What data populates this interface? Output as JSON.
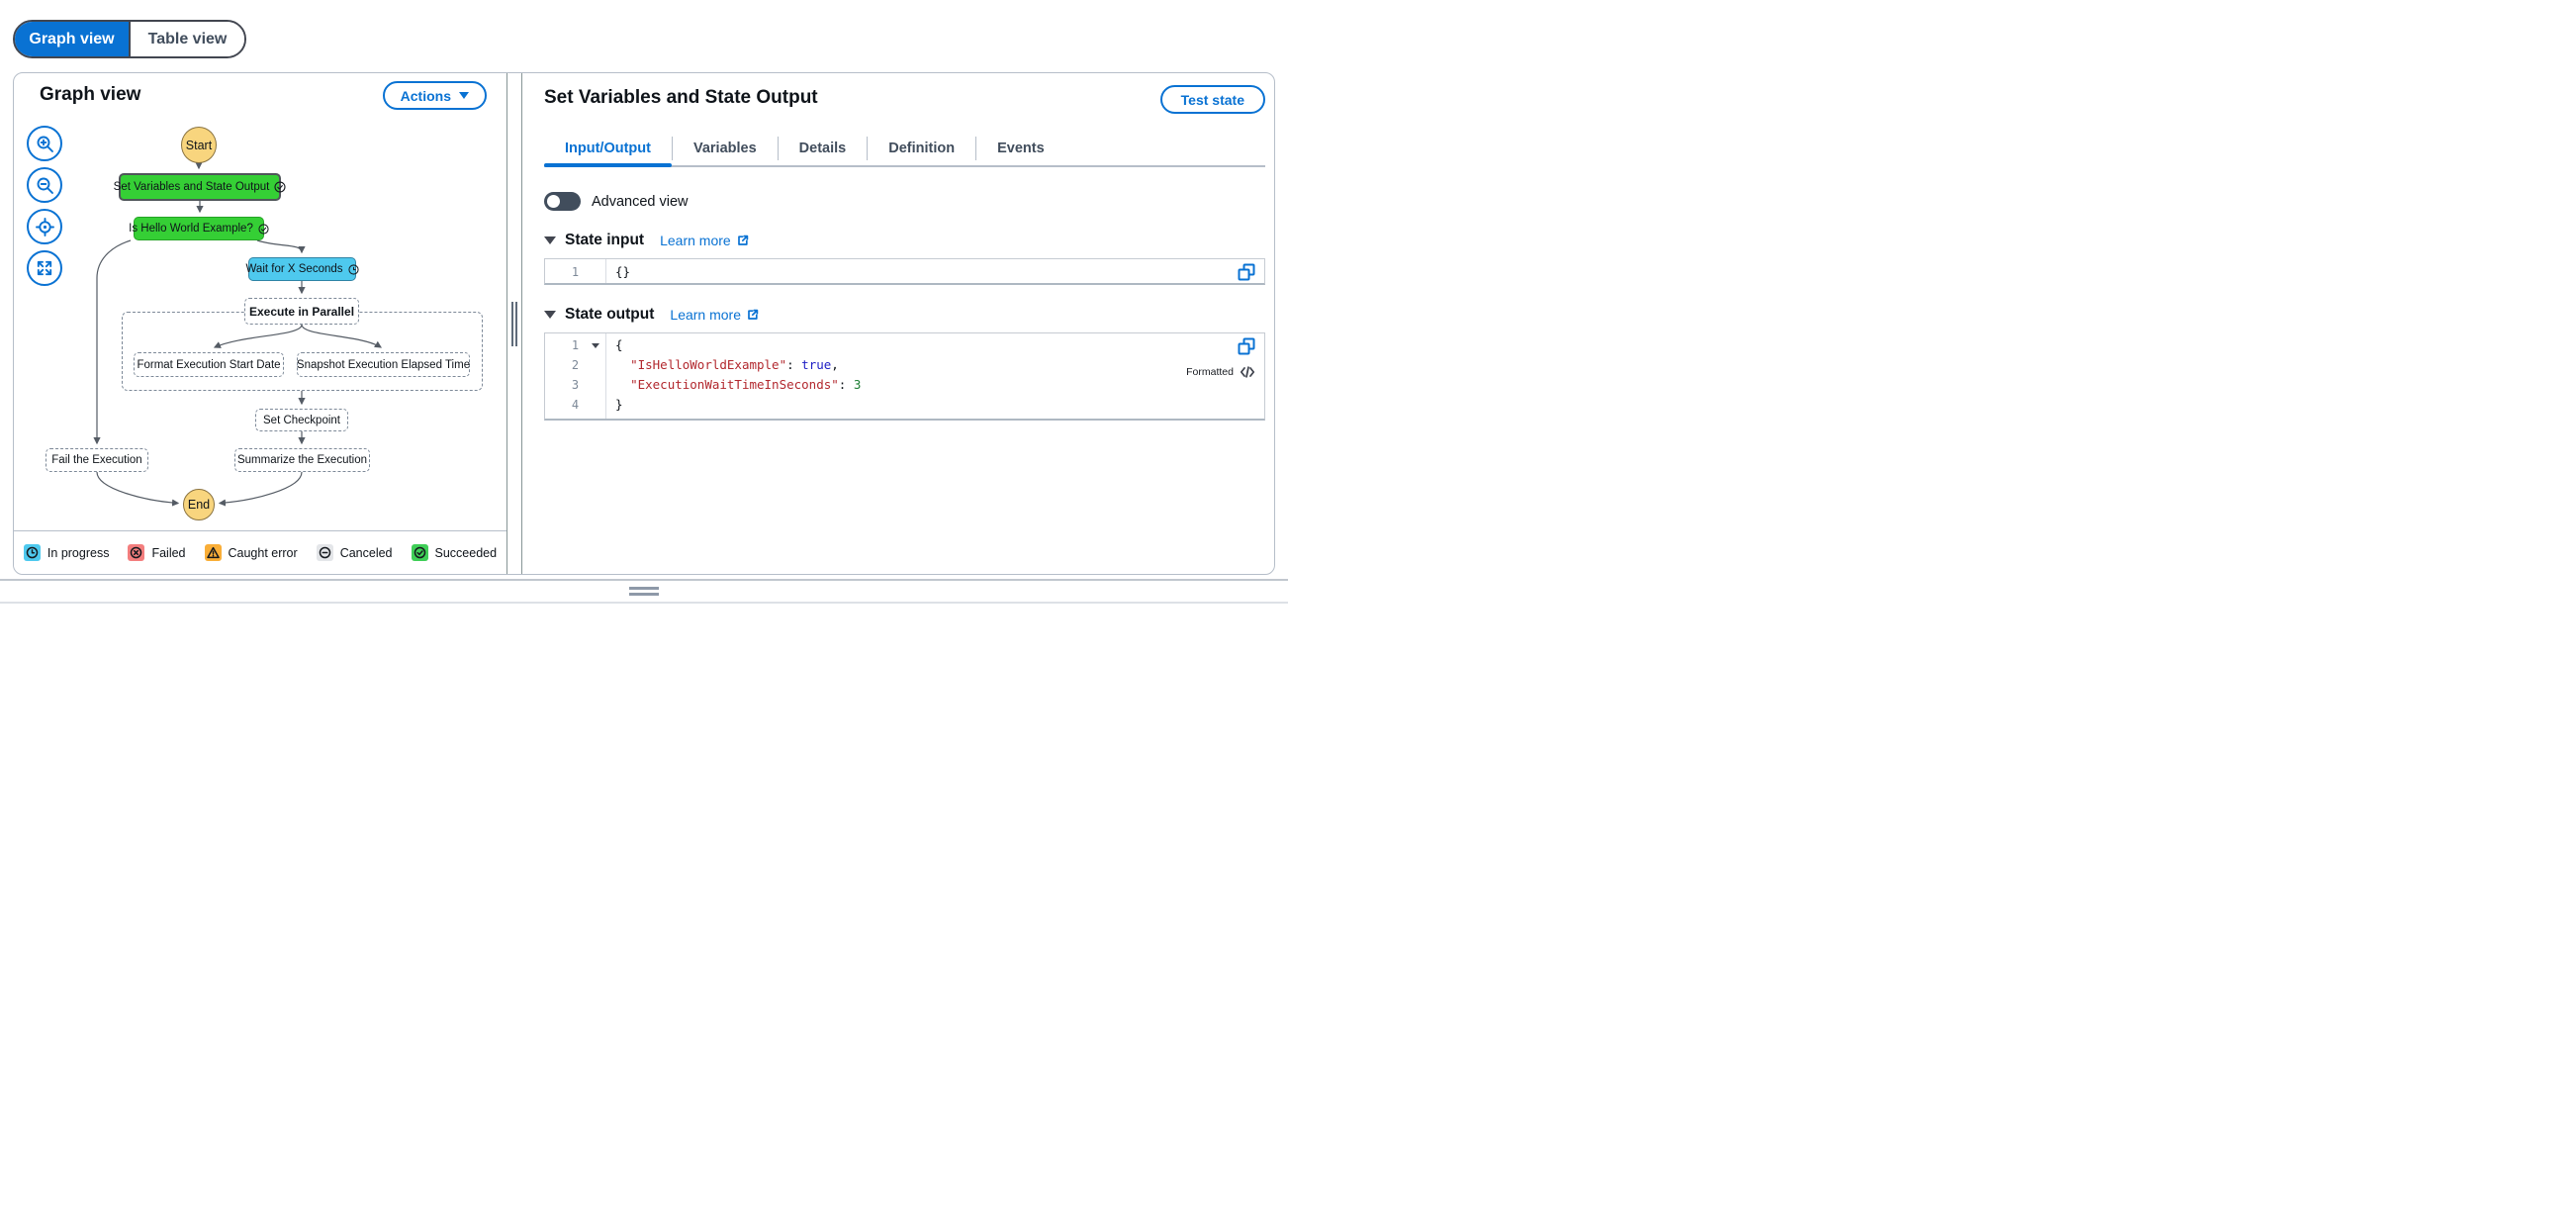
{
  "view_toggle": {
    "graph": "Graph view",
    "table": "Table view"
  },
  "left_panel": {
    "title": "Graph view",
    "actions_button": "Actions"
  },
  "graph": {
    "start": "Start",
    "set_variables": "Set Variables and State Output",
    "is_hello_world": "Is Hello World Example?",
    "wait": "Wait for X Seconds",
    "execute_parallel": "Execute in Parallel",
    "format_date": "Format Execution Start Date",
    "snapshot_time": "Snapshot Execution Elapsed Time",
    "set_checkpoint": "Set Checkpoint",
    "summarize": "Summarize the Execution",
    "fail": "Fail the Execution",
    "end": "End"
  },
  "legend": {
    "in_progress": "In progress",
    "failed": "Failed",
    "caught_error": "Caught error",
    "canceled": "Canceled",
    "succeeded": "Succeeded"
  },
  "details_panel": {
    "title": "Set Variables and State Output",
    "test_state_button": "Test state",
    "tabs": [
      {
        "label": "Input/Output"
      },
      {
        "label": "Variables"
      },
      {
        "label": "Details"
      },
      {
        "label": "Definition"
      },
      {
        "label": "Events"
      }
    ],
    "advanced_view_label": "Advanced view",
    "state_input": {
      "header": "State input",
      "learn_more": "Learn more",
      "line_number": "1",
      "code": "{}"
    },
    "state_output": {
      "header": "State output",
      "learn_more": "Learn more",
      "formatted_label": "Formatted",
      "gutter": [
        "1",
        "2",
        "3",
        "4"
      ],
      "l1": "{",
      "l2_indent": "  ",
      "l2_key": "\"IsHelloWorldExample\"",
      "l2_sep": ": ",
      "l2_val": "true",
      "l2_end": ",",
      "l3_indent": "  ",
      "l3_key": "\"ExecutionWaitTimeInSeconds\"",
      "l3_sep": ": ",
      "l3_val": "3",
      "l4": "}"
    }
  },
  "colors": {
    "primary_blue": "#0972d3",
    "succeeded_green": "#35cf35",
    "in_progress_blue": "#4ec9ee",
    "start_end_yellow": "#f8d57e",
    "failed_red": "#f37e7e",
    "caught_orange": "#f9ae38",
    "canceled_gray": "#e4e6e9",
    "legend_green": "#3fce57",
    "edge_gray": "#545b64"
  }
}
